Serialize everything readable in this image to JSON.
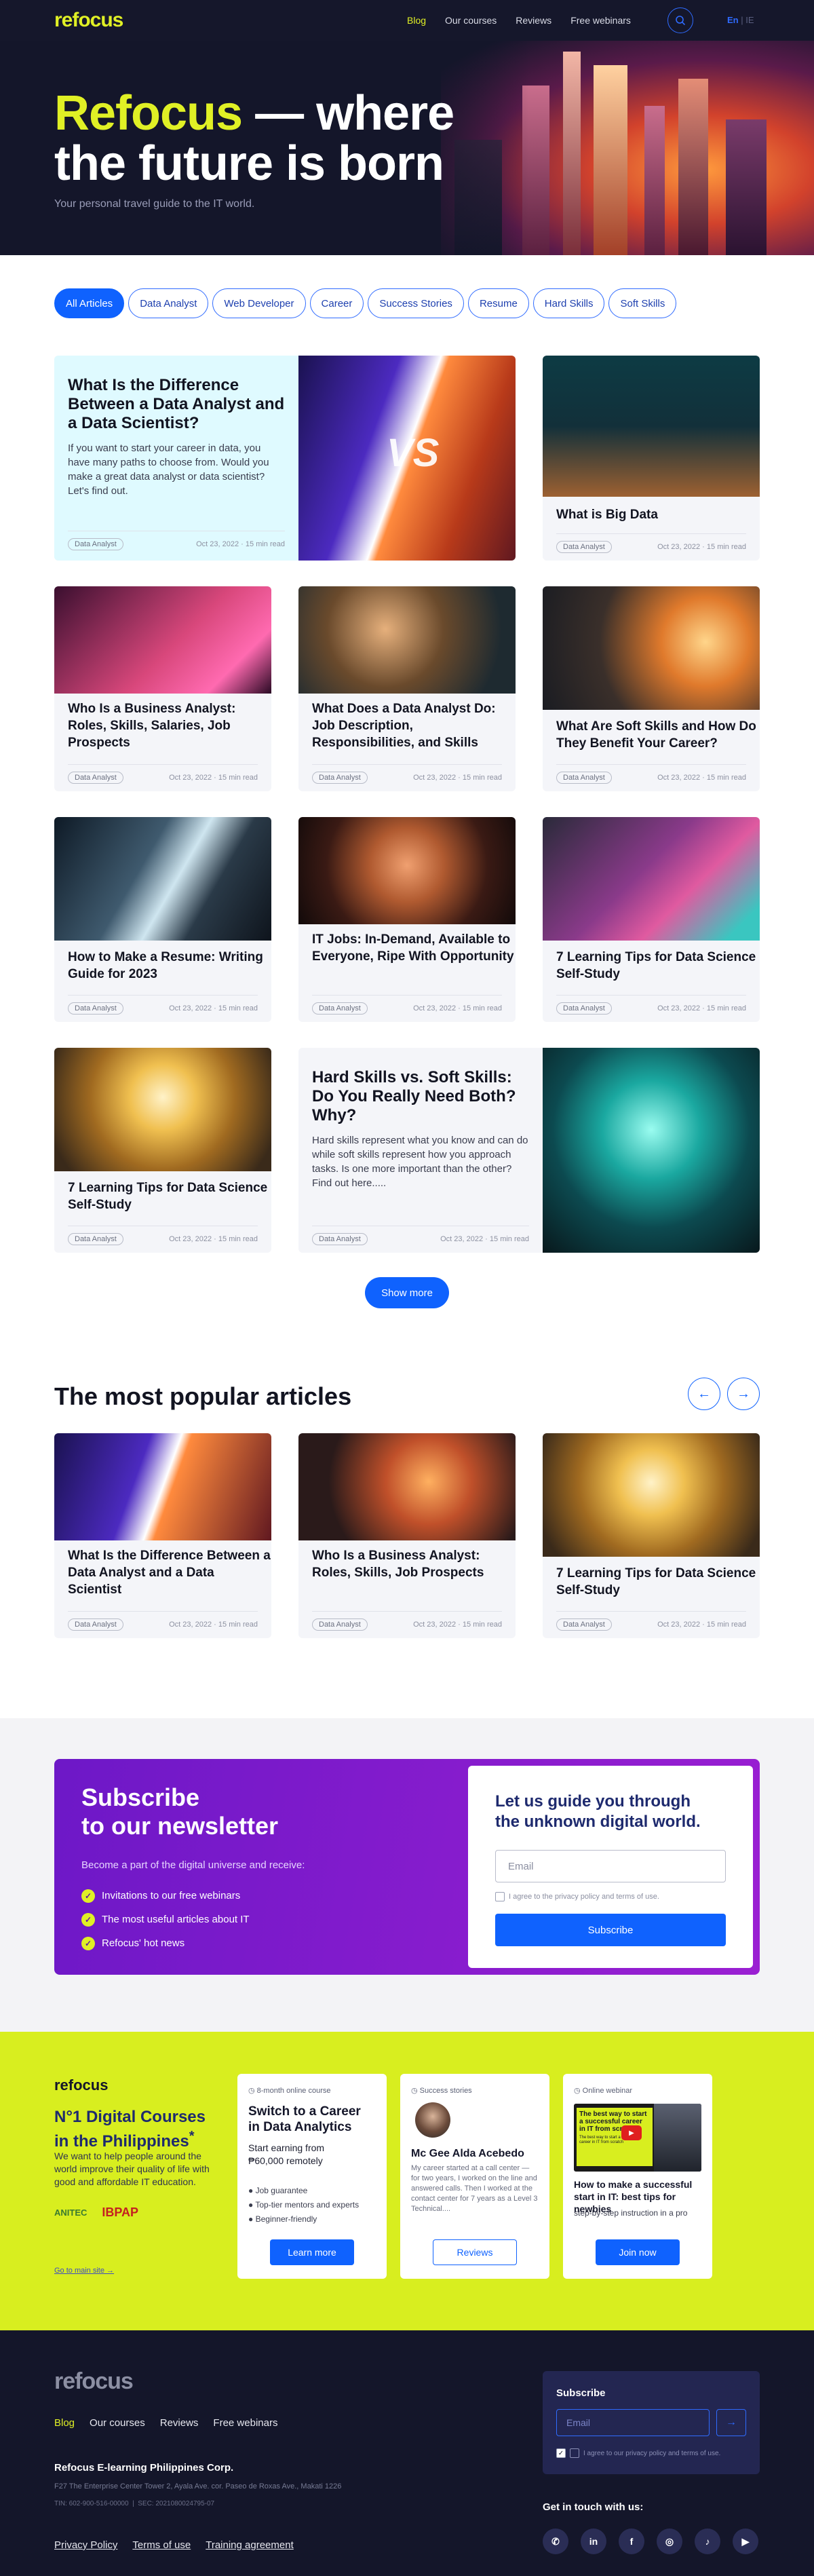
{
  "brand": {
    "logo": "refocus"
  },
  "nav": {
    "items": [
      {
        "label": "Blog",
        "active": true
      },
      {
        "label": "Our courses"
      },
      {
        "label": "Reviews"
      },
      {
        "label": "Free webinars"
      }
    ],
    "lang_en": "En",
    "lang_sep": "|",
    "lang_other": "IE"
  },
  "hero": {
    "title_highlight": "Refocus",
    "title_rest": " — where",
    "title_line2": "the future is born",
    "subtitle": "Your personal travel guide to the IT world."
  },
  "filters": [
    "All Articles",
    "Data Analyst",
    "Web Developer",
    "Career",
    "Success Stories",
    "Resume",
    "Hard Skills",
    "Soft Skills"
  ],
  "articles": [
    {
      "title": "What Is the Difference Between a Data Analyst and a Data Scientist?",
      "excerpt": "If you want to start your career in data, you have many paths to choose from. Would you make a great data analyst or data scientist? Let's find out.",
      "tag": "Data Analyst",
      "date": "Oct 23, 2022",
      "read": "15 min read"
    },
    {
      "title": "What is Big Data",
      "tag": "Data Analyst",
      "date": "Oct 23, 2022",
      "read": "15 min read"
    },
    {
      "title": "Who Is a Business Analyst: Roles, Skills, Salaries, Job Prospects",
      "tag": "Data Analyst",
      "date": "Oct 23, 2022",
      "read": "15 min read"
    },
    {
      "title": "What Does a Data Analyst Do: Job Description, Responsibilities, and Skills",
      "tag": "Data Analyst",
      "date": "Oct 23, 2022",
      "read": "15 min read"
    },
    {
      "title": "What Are Soft Skills and How Do They Benefit Your Career?",
      "tag": "Data Analyst",
      "date": "Oct 23, 2022",
      "read": "15 min read"
    },
    {
      "title": "How to Make a Resume: Writing Guide for 2023",
      "tag": "Data Analyst",
      "date": "Oct 23, 2022",
      "read": "15 min read"
    },
    {
      "title": "IT Jobs: In-Demand, Available to Everyone, Ripe With Opportunity",
      "tag": "Data Analyst",
      "date": "Oct 23, 2022",
      "read": "15 min read"
    },
    {
      "title": "7 Learning Tips for Data Science Self-Study",
      "tag": "Data Analyst",
      "date": "Oct 23, 2022",
      "read": "15 min read"
    },
    {
      "title": "7 Learning Tips for Data Science Self-Study",
      "tag": "Data Analyst",
      "date": "Oct 23, 2022",
      "read": "15 min read"
    },
    {
      "title": "Hard Skills vs. Soft Skills: Do You Really Need Both? Why?",
      "excerpt": "Hard skills represent what you know and can do while soft skills represent how you approach tasks. Is one more important than the other? Find out here.....",
      "tag": "Data Analyst",
      "date": "Oct 23, 2022",
      "read": "15 min read"
    }
  ],
  "show_more": "Show more",
  "popular": {
    "title": "The most popular articles",
    "items": [
      {
        "title": "What Is the Difference Between a Data Analyst and a Data Scientist",
        "tag": "Data Analyst",
        "date": "Oct 23, 2022",
        "read": "15 min read"
      },
      {
        "title": "Who Is a Business Analyst: Roles, Skills, Job Prospects",
        "tag": "Data Analyst",
        "date": "Oct 23, 2022",
        "read": "15 min read"
      },
      {
        "title": "7 Learning Tips for Data Science Self-Study",
        "tag": "Data Analyst",
        "date": "Oct 23, 2022",
        "read": "15 min read"
      }
    ]
  },
  "newsletter": {
    "title_l1": "Subscribe",
    "title_l2": "to our newsletter",
    "sub": "Become a part of the digital universe and receive:",
    "bullets": [
      "Invitations to our free webinars",
      "The most useful articles about IT",
      "Refocus' hot news"
    ],
    "form_title_l1": "Let us guide you through",
    "form_title_l2": "the unknown digital world.",
    "email_placeholder": "Email",
    "agree": "I agree to the privacy policy and terms of use.",
    "button": "Subscribe"
  },
  "promo": {
    "logo": "refocus",
    "title_l1": "N°1 Digital Courses",
    "title_l2": "in the Philippines",
    "sup": "*",
    "text": "We want to help people around the world improve their quality of life with good and affordable IT education.",
    "partner1": "ANITEC",
    "partner2": "IBPAP",
    "link": "Go to main site →",
    "card1": {
      "label": "8-month online course",
      "title_l1": "Switch to a Career",
      "title_l2": "in Data Analytics",
      "sub_l1": "Start earning from",
      "sub_l2": "₱60,000 remotely",
      "items": [
        "Job guarantee",
        "Top-tier mentors and experts",
        "Beginner-friendly"
      ],
      "button": "Learn more"
    },
    "card2": {
      "label": "Success stories",
      "name": "Mc Gee Alda Acebedo",
      "text": "My career started at a call center — for two years, I worked on the line and answered calls. Then I worked at the contact center for 7 years as a Level 3 Technical....",
      "button": "Reviews"
    },
    "card3": {
      "label": "Online webinar",
      "thumb_l1": "The best way to start",
      "thumb_l2": "a successful career",
      "thumb_l3": "in IT from scratch",
      "thumb_small": "The best way to start a successful career in IT from scratch",
      "title": "How to make a successful start in IT: best tips for newbies",
      "sub": "step-by-step instruction in a pro",
      "button": "Join now"
    }
  },
  "footer": {
    "logo": "refocus",
    "nav": [
      "Blog",
      "Our courses",
      "Reviews",
      "Free webinars"
    ],
    "company": "Refocus E-learning Philippines Corp.",
    "address": "F27 The Enterprise Center Tower 2, Ayala Ave. cor. Paseo de Roxas Ave., Makati 1226",
    "tin": "TIN: 602-900-516-00000",
    "sec": "SEC: 2021080024795-07",
    "links": [
      "Privacy Policy",
      "Terms of use",
      "Training agreement"
    ],
    "sub_title": "Subscribe",
    "email_placeholder": "Email",
    "agree": "I agree to our privacy policy and terms of use.",
    "get_in_touch": "Get in touch with us:",
    "social": [
      "whatsapp-icon",
      "linkedin-icon",
      "facebook-icon",
      "instagram-icon",
      "tiktok-icon",
      "youtube-icon"
    ]
  },
  "colors": {
    "accent": "#0f62fe",
    "lime": "#e0f025",
    "navy": "#14162a",
    "purple": "#8a1dd0"
  }
}
